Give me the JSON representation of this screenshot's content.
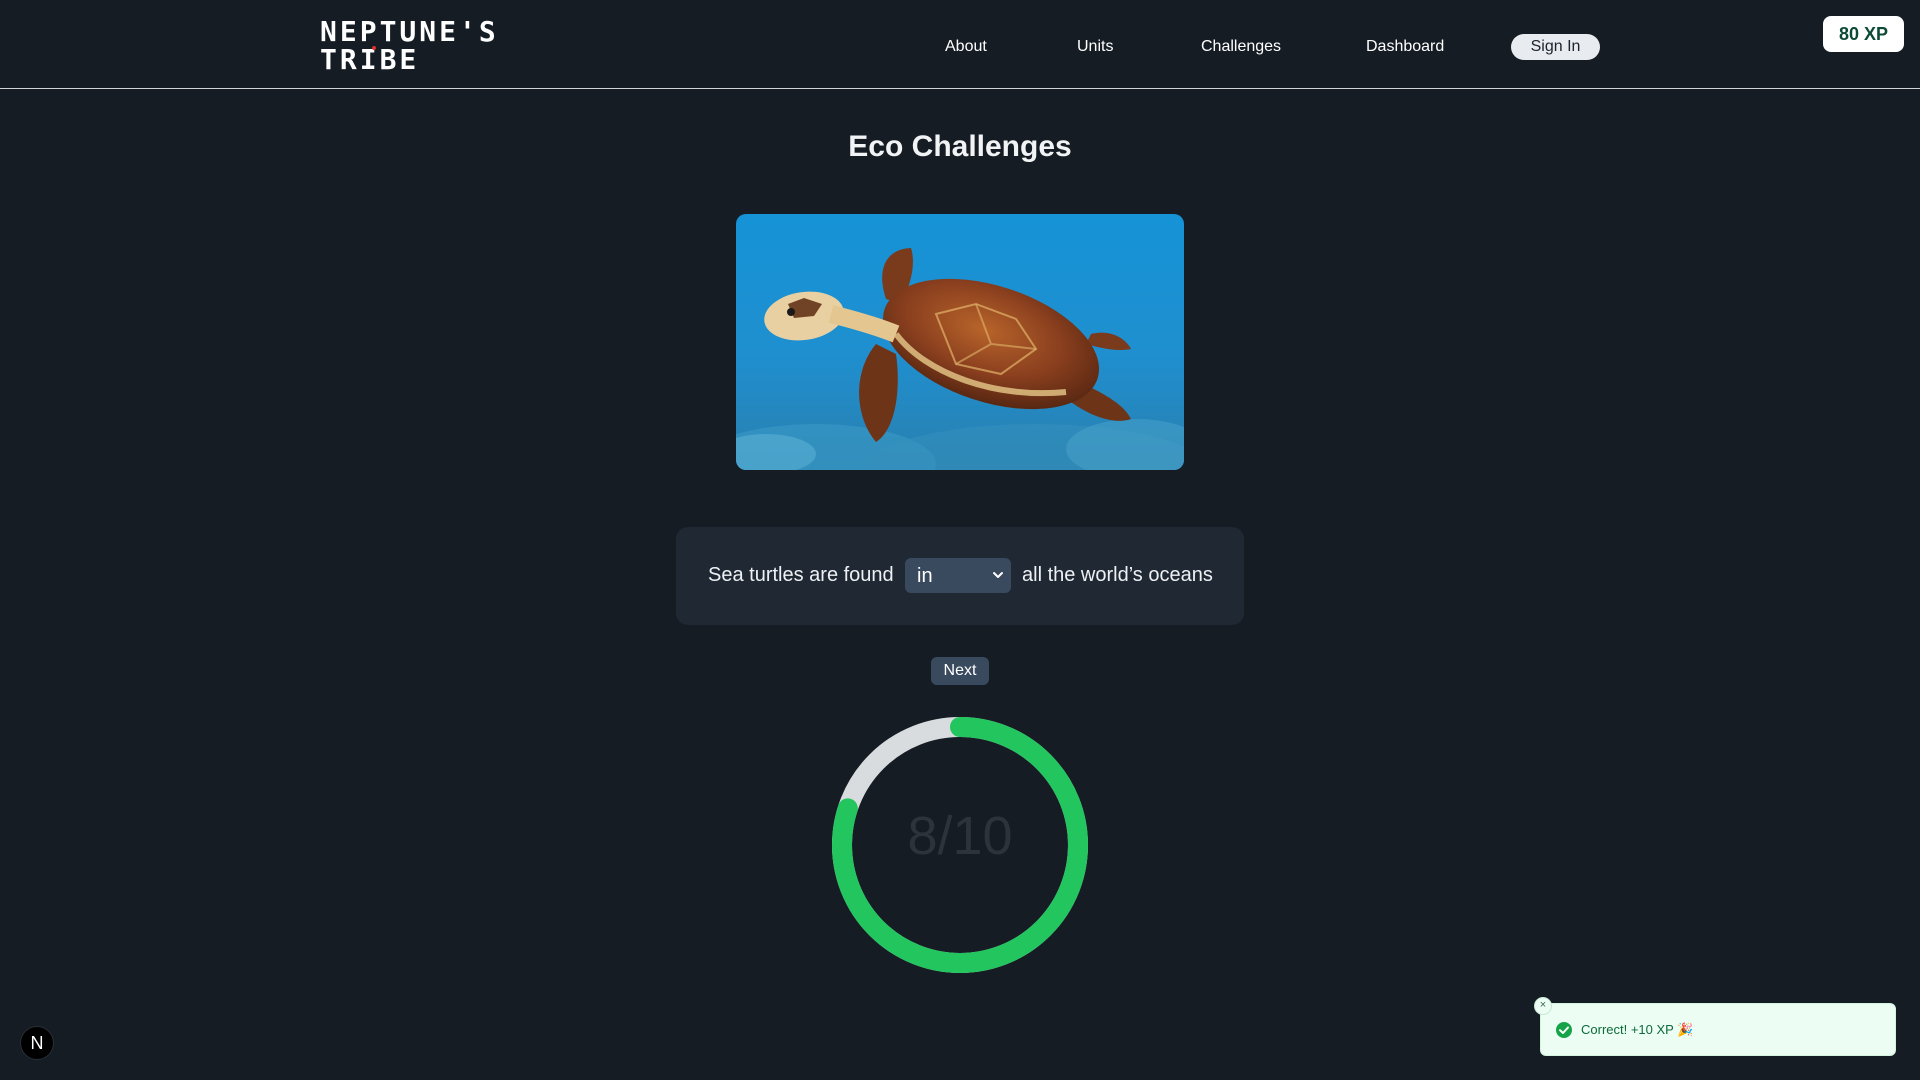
{
  "brand": {
    "line1": "NEPTUNE'S",
    "line2": "TRIBE",
    "accent_color": "#e0302a"
  },
  "nav": {
    "items": [
      {
        "label": "About"
      },
      {
        "label": "Units"
      },
      {
        "label": "Challenges"
      },
      {
        "label": "Dashboard"
      }
    ],
    "sign_in_label": "Sign In"
  },
  "xp": {
    "label": "80 XP"
  },
  "page": {
    "title": "Eco Challenges"
  },
  "challenge": {
    "image_icon": "sea-turtle-photo",
    "prefix": "Sea turtles are found",
    "selected_option": "in",
    "suffix": "all the world’s oceans"
  },
  "controls": {
    "next_label": "Next"
  },
  "progress": {
    "label": "8/10",
    "current": 8,
    "total": 10,
    "fill_color": "#22c55e",
    "track_color": "#d9dcdf"
  },
  "devtools": {
    "badge_label": "N"
  },
  "toast": {
    "message": "Correct! +10 XP 🎉",
    "close_label": "×",
    "status_color": "#16a34a"
  }
}
